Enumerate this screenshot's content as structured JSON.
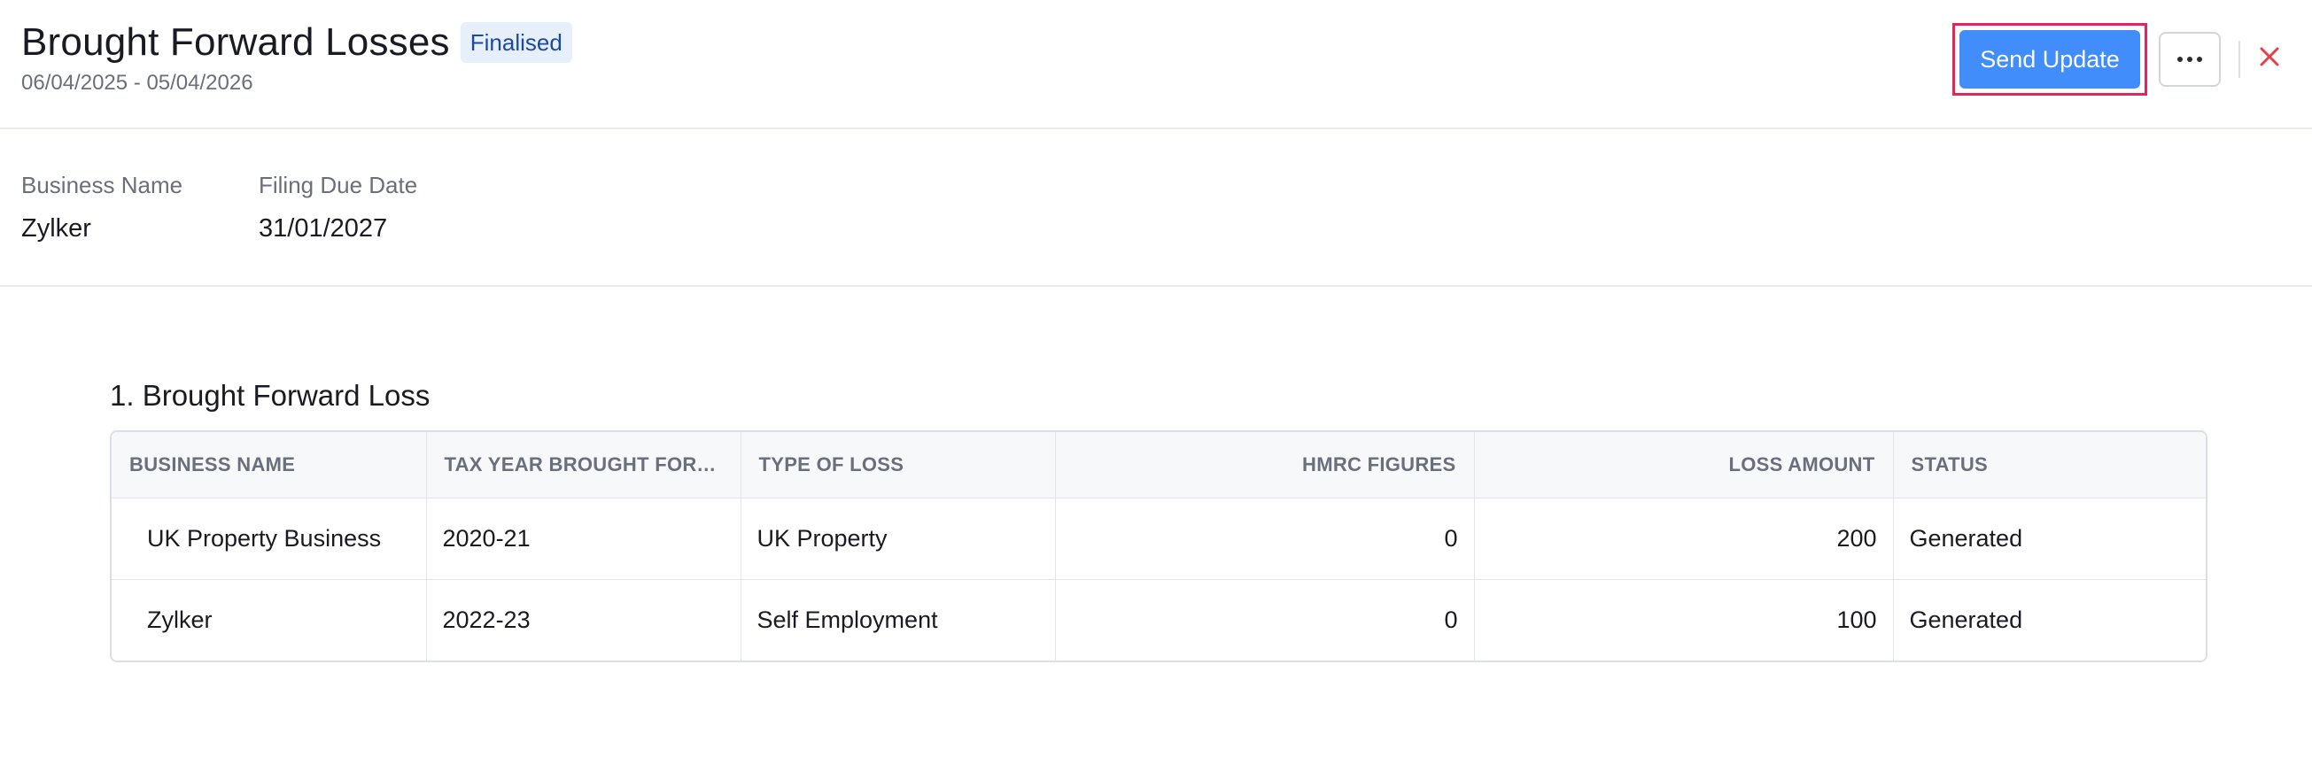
{
  "header": {
    "title": "Brought Forward Losses",
    "status": "Finalised",
    "date_range": "06/04/2025 - 05/04/2026",
    "send_update_label": "Send Update",
    "more_icon": "more-horizontal-icon",
    "close_icon": "close-icon",
    "close_color": "#e5414b",
    "accent": "#408dfb",
    "highlight_color": "#e5245b"
  },
  "details": {
    "business_name_label": "Business Name",
    "business_name_value": "Zylker",
    "filing_due_label": "Filing Due Date",
    "filing_due_value": "31/01/2027"
  },
  "section": {
    "title": "1. Brought Forward Loss"
  },
  "table": {
    "columns": [
      "BUSINESS NAME",
      "TAX YEAR BROUGHT FORW...",
      "TYPE OF LOSS",
      "HMRC FIGURES",
      "LOSS AMOUNT",
      "STATUS"
    ],
    "rows": [
      [
        "UK Property Business",
        "2020-21",
        "UK Property",
        "0",
        "200",
        "Generated"
      ],
      [
        "Zylker",
        "2022-23",
        "Self Employment",
        "0",
        "100",
        "Generated"
      ]
    ]
  }
}
